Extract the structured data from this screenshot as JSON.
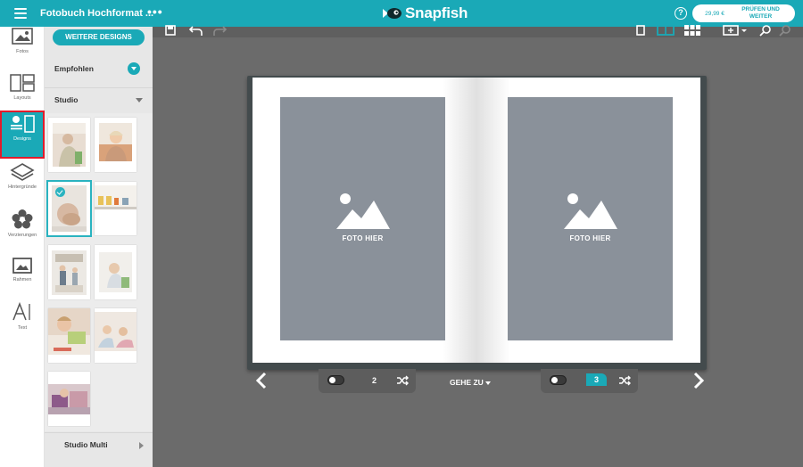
{
  "header": {
    "doc_title": "Fotobuch Hochformat ...",
    "more": "•••",
    "brand": "Snapfish",
    "help": "?",
    "price": "29,99 €",
    "cta_line1": "PRÜFEN UND",
    "cta_line2": "WEITER"
  },
  "tools": [
    {
      "label": "Fotos",
      "icon": "photos-icon"
    },
    {
      "label": "Layouts",
      "icon": "layouts-icon"
    },
    {
      "label": "Designs",
      "icon": "designs-icon",
      "active": true
    },
    {
      "label": "Hintergründe",
      "icon": "backgrounds-icon"
    },
    {
      "label": "Verzierungen",
      "icon": "embellishments-icon"
    },
    {
      "label": "Rahmen",
      "icon": "frames-icon"
    },
    {
      "label": "Text",
      "icon": "text-icon"
    }
  ],
  "panel": {
    "more_designs": "WEITERE DESIGNS",
    "empfohlen": "Empfohlen",
    "studio": "Studio",
    "studio_multi": "Studio Multi"
  },
  "book": {
    "placeholder": "FOTO HIER"
  },
  "controls": {
    "left_page": "2",
    "right_page": "3",
    "goto": "GEHE ZU"
  },
  "colors": {
    "accent": "#1aa9b7",
    "selection_outline": "#e21b2b",
    "canvas": "#6b6b6b",
    "photo_slot": "#8a919a"
  }
}
